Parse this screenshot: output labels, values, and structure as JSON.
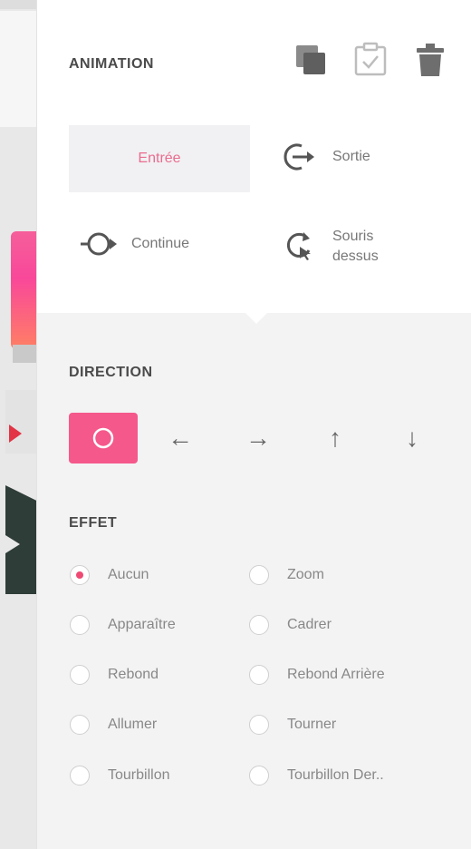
{
  "panel": {
    "animation_heading": "ANIMATION",
    "direction_heading": "DIRECTION",
    "effect_heading": "EFFET"
  },
  "toolbar": {
    "icons": [
      "duplicate-icon",
      "clipboard-check-icon",
      "trash-icon"
    ]
  },
  "animation_types": {
    "entree": "Entrée",
    "sortie": "Sortie",
    "continue": "Continue",
    "souris_line1": "Souris",
    "souris_line2": "dessus",
    "selected": "Entrée"
  },
  "direction": {
    "options": [
      "none",
      "left",
      "right",
      "up",
      "down"
    ],
    "selected": "none",
    "glyphs": {
      "left": "←",
      "right": "→",
      "up": "↑",
      "down": "↓"
    }
  },
  "effects": {
    "selected": "Aucun",
    "items": [
      "Aucun",
      "Zoom",
      "Apparaître",
      "Cadrer",
      "Rebond",
      "Rebond Arrière",
      "Allumer",
      "Tourner",
      "Tourbillon",
      "Tourbillon Der.."
    ]
  },
  "colors": {
    "accent": "#f5588b",
    "accent_text": "#ea6d8f",
    "radio_dot": "#ef4a73"
  }
}
